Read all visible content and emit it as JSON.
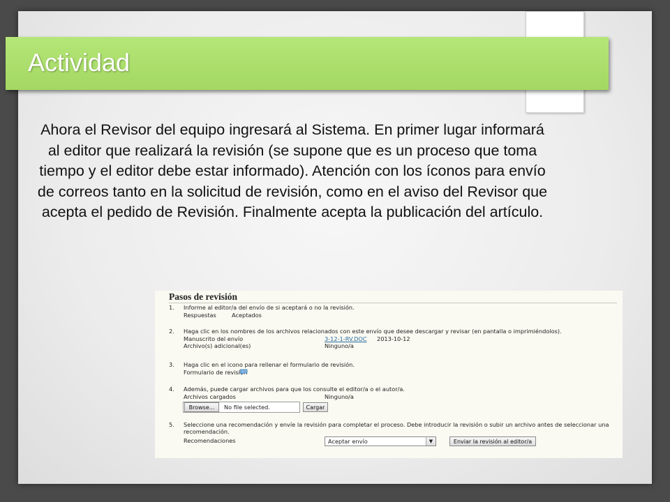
{
  "slide": {
    "title": "Actividad",
    "body": "Ahora el Revisor del equipo ingresará al Sistema. En primer lugar informará al editor que realizará la revisión (se supone que es un proceso que toma tiempo y el editor debe estar informado). Atención con los íconos para envío de correos tanto en la solicitud de revisión, como en el aviso del Revisor que acepta el pedido de Revisión. Finalmente acepta la publicación del artículo."
  },
  "screenshot": {
    "heading": "Pasos de revisión",
    "step1": {
      "num": "1.",
      "text": "Informe al editor/a del envío de si aceptará o no la revisión.",
      "links": [
        "Respuestas",
        "Aceptados"
      ]
    },
    "step2": {
      "num": "2.",
      "text": "Haga clic en los nombres de los archivos relacionados con este envío que desee descargar y revisar (en pantalla o imprimiéndolos).",
      "manuscript_label": "Manuscrito del envío",
      "manuscript_file": "3-12-1-RV.DOC",
      "manuscript_date": "2013-10-12",
      "extra_label": "Archivo(s) adicional(es)",
      "extra_value": "Ninguno/a"
    },
    "step3": {
      "num": "3.",
      "text": "Haga clic en el icono para rellenar el formulario de revisión.",
      "form_label": "Formulario de revisión"
    },
    "step4": {
      "num": "4.",
      "text": "Además, puede cargar archivos para que los consulte el editor/a o el autor/a.",
      "uploaded_label": "Archivos cargados",
      "uploaded_value": "Ninguno/a",
      "browse_label": "Browse...",
      "file_status": "No file selected.",
      "upload_button": "Cargar"
    },
    "step5": {
      "num": "5.",
      "text": "Seleccione una recomendación y envíe la revisión para completar el proceso. Debe introducir la revisión o subir un archivo antes de seleccionar una recomendación.",
      "recommend_label": "Recomendaciones",
      "selected_option": "Aceptar envío",
      "submit_button": "Enviar la revisión al editor/a"
    }
  },
  "colors": {
    "banner": "#a8dc6a",
    "link": "#2a6a9a"
  },
  "icons": [
    "comment-icon",
    "chevron-down-icon"
  ]
}
